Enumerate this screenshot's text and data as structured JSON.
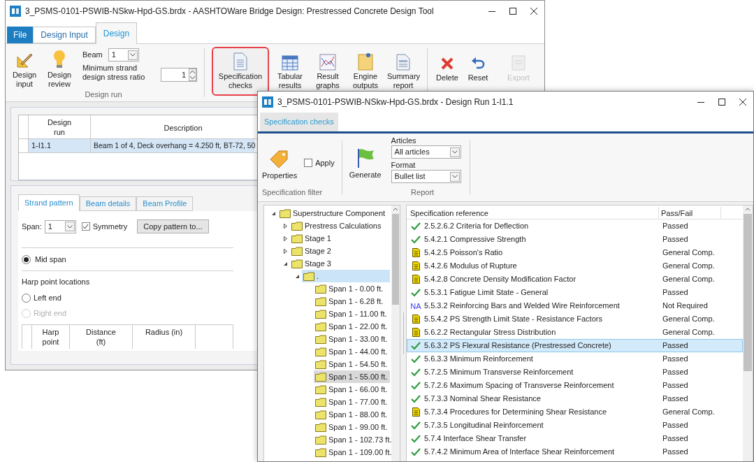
{
  "back_window": {
    "title": "3_PSMS-0101-PSWIB-NSkw-Hpd-GS.brdx - AASHTOWare Bridge Design: Prestressed Concrete Design Tool",
    "tabs": [
      {
        "label": "File",
        "kind": "file",
        "selected": false
      },
      {
        "label": "Design Input",
        "kind": "tab",
        "selected": false
      },
      {
        "label": "Design",
        "kind": "tab",
        "selected": true
      }
    ],
    "ribbon": {
      "group_label": "Design run",
      "design_buttons": [
        {
          "label": "Design input",
          "kind": "pencil"
        },
        {
          "label": "Design review",
          "kind": "bulb"
        }
      ],
      "beam_label": "Beam",
      "beam_value": "1",
      "ratio_label": "Minimum strand design stress ratio",
      "ratio_value": "1",
      "output_buttons": [
        {
          "label": "Specification checks",
          "kind": "document",
          "highlighted": true
        },
        {
          "label": "Tabular results",
          "kind": "table",
          "highlighted": false
        },
        {
          "label": "Result graphs",
          "kind": "graph",
          "highlighted": false
        },
        {
          "label": "Engine outputs",
          "kind": "notes",
          "highlighted": false
        },
        {
          "label": "Summary report",
          "kind": "report",
          "highlighted": false
        }
      ],
      "action_buttons": [
        {
          "label": "Delete",
          "kind": "delete",
          "disabled": false
        },
        {
          "label": "Reset",
          "kind": "reset",
          "disabled": false
        },
        {
          "label": "Export",
          "kind": "export",
          "disabled": true
        }
      ]
    },
    "design_runs": {
      "columns": [
        "Design run",
        "Description"
      ],
      "rows": [
        {
          "cells": [
            "1-I1.1",
            "Beam 1 of 4, Deck overhang = 4.250 ft, BT-72, 50"
          ],
          "selected": true
        }
      ]
    },
    "strand_panel": {
      "tabs": [
        {
          "label": "Strand pattern",
          "selected": true
        },
        {
          "label": "Beam details",
          "selected": false
        },
        {
          "label": "Beam Profile",
          "selected": false
        }
      ],
      "span_label": "Span:",
      "span_value": "1",
      "symmetry": {
        "label": "Symmetry",
        "checked": true
      },
      "copy_button": "Copy pattern to...",
      "mid_span": {
        "label": "Mid span",
        "selected": true
      },
      "harp_heading": "Harp point locations",
      "harp_options": [
        {
          "label": "Left end",
          "selected": false,
          "disabled": false
        },
        {
          "label": "Right end",
          "selected": false,
          "disabled": true
        }
      ],
      "harp_columns": [
        "Harp point",
        "Distance (ft)",
        "Radius (in)"
      ]
    }
  },
  "front_window": {
    "title": "3_PSMS-0101-PSWIB-NSkw-Hpd-GS.brdx - Design Run 1-I1.1",
    "tabs": [
      {
        "label": "Specification checks",
        "selected": true
      }
    ],
    "filter_group": {
      "properties": "Properties",
      "apply": {
        "label": "Apply",
        "checked": false
      },
      "label": "Specification filter"
    },
    "report_group": {
      "generate": "Generate",
      "articles_label": "Articles",
      "articles_value": "All articles",
      "format_label": "Format",
      "format_value": "Bullet list",
      "label": "Report"
    },
    "tree": [
      {
        "label": "Superstructure Component",
        "expanded": true,
        "selected": false,
        "children": [
          {
            "label": "Prestress Calculations",
            "expanded": false,
            "selected": false
          },
          {
            "label": "Stage 1",
            "expanded": false,
            "selected": false
          },
          {
            "label": "Stage 2",
            "expanded": false,
            "selected": false
          },
          {
            "label": "Stage 3",
            "expanded": true,
            "selected": false,
            "children": [
              {
                "label": ".",
                "expanded": true,
                "selected": true,
                "children": [
                  {
                    "label": "Span 1 - 0.00 ft.",
                    "selected": false,
                    "hovered": false
                  },
                  {
                    "label": "Span 1 - 6.28 ft.",
                    "selected": false,
                    "hovered": false
                  },
                  {
                    "label": "Span 1 - 11.00 ft.",
                    "selected": false,
                    "hovered": false
                  },
                  {
                    "label": "Span 1 - 22.00 ft.",
                    "selected": false,
                    "hovered": false
                  },
                  {
                    "label": "Span 1 - 33.00 ft.",
                    "selected": false,
                    "hovered": false
                  },
                  {
                    "label": "Span 1 - 44.00 ft.",
                    "selected": false,
                    "hovered": false
                  },
                  {
                    "label": "Span 1 - 54.50 ft.",
                    "selected": false,
                    "hovered": false
                  },
                  {
                    "label": "Span 1 - 55.00 ft.",
                    "selected": false,
                    "hovered": true
                  },
                  {
                    "label": "Span 1 - 66.00 ft.",
                    "selected": false,
                    "hovered": false
                  },
                  {
                    "label": "Span 1 - 77.00 ft.",
                    "selected": false,
                    "hovered": false
                  },
                  {
                    "label": "Span 1 - 88.00 ft.",
                    "selected": false,
                    "hovered": false
                  },
                  {
                    "label": "Span 1 - 99.00 ft.",
                    "selected": false,
                    "hovered": false
                  },
                  {
                    "label": "Span 1 - 102.73 ft.",
                    "selected": false,
                    "hovered": false
                  },
                  {
                    "label": "Span 1 - 109.00 ft.",
                    "selected": false,
                    "hovered": false
                  }
                ]
              }
            ]
          }
        ]
      }
    ],
    "spec_table": {
      "columns": [
        "Specification reference",
        "Pass/Fail"
      ],
      "rows": [
        {
          "kind": "pass",
          "reference": "2.5.2.6.2 Criteria for Deflection",
          "result": "Passed",
          "selected": false
        },
        {
          "kind": "pass",
          "reference": "5.4.2.1 Compressive Strength",
          "result": "Passed",
          "selected": false
        },
        {
          "kind": "general",
          "reference": "5.4.2.5 Poisson's Ratio",
          "result": "General Comp.",
          "selected": false
        },
        {
          "kind": "general",
          "reference": "5.4.2.6 Modulus of Rupture",
          "result": "General Comp.",
          "selected": false
        },
        {
          "kind": "general",
          "reference": "5.4.2.8 Concrete Density Modification Factor",
          "result": "General Comp.",
          "selected": false
        },
        {
          "kind": "pass",
          "reference": "5.5.3.1 Fatigue Limit State - General",
          "result": "Passed",
          "selected": false
        },
        {
          "kind": "na",
          "badge": "NA",
          "reference": "5.5.3.2 Reinforcing Bars and Welded Wire Reinforcement",
          "result": "Not Required",
          "selected": false
        },
        {
          "kind": "general",
          "reference": "5.5.4.2 PS Strength Limit State - Resistance Factors",
          "result": "General Comp.",
          "selected": false
        },
        {
          "kind": "general",
          "reference": "5.6.2.2 Rectangular Stress Distribution",
          "result": "General Comp.",
          "selected": false
        },
        {
          "kind": "pass",
          "reference": "5.6.3.2 PS Flexural Resistance (Prestressed Concrete)",
          "result": "Passed",
          "selected": true
        },
        {
          "kind": "pass",
          "reference": "5.6.3.3 Minimum Reinforcement",
          "result": "Passed",
          "selected": false
        },
        {
          "kind": "pass",
          "reference": "5.7.2.5 Minimum Transverse Reinforcement",
          "result": "Passed",
          "selected": false
        },
        {
          "kind": "pass",
          "reference": "5.7.2.6 Maximum Spacing of Transverse Reinforcement",
          "result": "Passed",
          "selected": false
        },
        {
          "kind": "pass",
          "reference": "5.7.3.3 Nominal Shear Resistance",
          "result": "Passed",
          "selected": false
        },
        {
          "kind": "general",
          "reference": "5.7.3.4 Procedures for Determining Shear Resistance",
          "result": "General Comp.",
          "selected": false
        },
        {
          "kind": "pass",
          "reference": "5.7.3.5 Longitudinal Reinforcement",
          "result": "Passed",
          "selected": false
        },
        {
          "kind": "pass",
          "reference": "5.7.4 Interface Shear Transfer",
          "result": "Passed",
          "selected": false
        },
        {
          "kind": "pass",
          "reference": "5.7.4.2 Minimum Area of Interface Shear Reinforcement",
          "result": "Passed",
          "selected": false
        }
      ]
    }
  }
}
